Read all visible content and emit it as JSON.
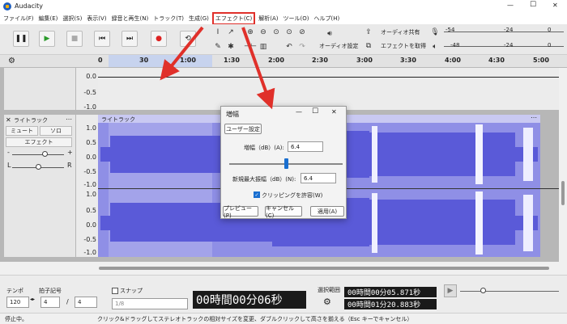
{
  "app": {
    "title": "Audacity",
    "window_min": "—",
    "window_max": "☐",
    "window_close": "✕"
  },
  "menu": [
    {
      "label": "ファイル(F)"
    },
    {
      "label": "編集(E)"
    },
    {
      "label": "選択(S)"
    },
    {
      "label": "表示(V)"
    },
    {
      "label": "録音と再生(N)"
    },
    {
      "label": "トラック(T)"
    },
    {
      "label": "生成(G)"
    },
    {
      "label": "エフェクト(C)"
    },
    {
      "label": "解析(A)"
    },
    {
      "label": "ツール(O)"
    },
    {
      "label": "ヘルプ(H)"
    }
  ],
  "toolbar": {
    "audio_setup": "オーディオ設定",
    "share_audio": "オーディオ共有",
    "get_effects": "エフェクトを取得",
    "meter_rec_1": "-54",
    "meter_rec_2": "-24",
    "meter_rec_3": "0",
    "meter_play_1": "-48",
    "meter_play_2": "-24",
    "meter_play_3": "0"
  },
  "ruler": {
    "ticks": [
      "0",
      "30",
      "1:00",
      "1:30",
      "2:00",
      "2:30",
      "3:00",
      "3:30",
      "4:00",
      "4:30",
      "5:00"
    ]
  },
  "tracks": {
    "upper_scale": [
      "0.0",
      "-0.5",
      "-1.0"
    ],
    "track_name": "ライトラック",
    "clip_name": "ライトラック",
    "mute": "ミュート",
    "solo": "ソロ",
    "effect": "エフェクト",
    "pan_l": "L",
    "pan_r": "R",
    "gain_minus": "-",
    "gain_plus": "+",
    "scale": [
      "1.0",
      "0.5",
      "0.0",
      "-0.5",
      "-1.0",
      "1.0",
      "0.5",
      "0.0",
      "-0.5",
      "-1.0"
    ]
  },
  "dialog": {
    "title": "増幅",
    "user_preset": "ユーザー設定",
    "amp_label": "増幅（dB）(A):",
    "amp_value": "6.4",
    "peak_label": "新規最大振幅（dB）(N):",
    "peak_value": "6.4",
    "allow_clip": "クリッピングを許容(W)",
    "preview": "プレビュー(P)",
    "cancel": "キャンセル(C)",
    "apply": "適用(A)",
    "slider_fraction": 0.5
  },
  "bottom": {
    "tempo_label": "テンポ",
    "tempo_value": "120",
    "time_sig_label": "拍子記号",
    "time_sig_num": "4",
    "time_sig_sep": "/",
    "time_sig_den": "4",
    "snap_label": "スナップ",
    "snap_value": "1/8",
    "time_display": "00時間00分06秒",
    "selection_label": "選択範囲",
    "sel_start": "00時間00分05.871秒",
    "sel_end": "00時間01分20.883秒"
  },
  "status": {
    "state": "停止中。",
    "hint": "クリック&ドラッグしてステレオトラックの相対サイズを変更、ダブルクリックして高さを揃える（Esc キーでキャンセル）"
  },
  "colors": {
    "waveform": "#5a5ad8",
    "waveform_bg": "#8f8fe6",
    "highlight_box": "#e0302a",
    "arrow": "#e0302a"
  }
}
